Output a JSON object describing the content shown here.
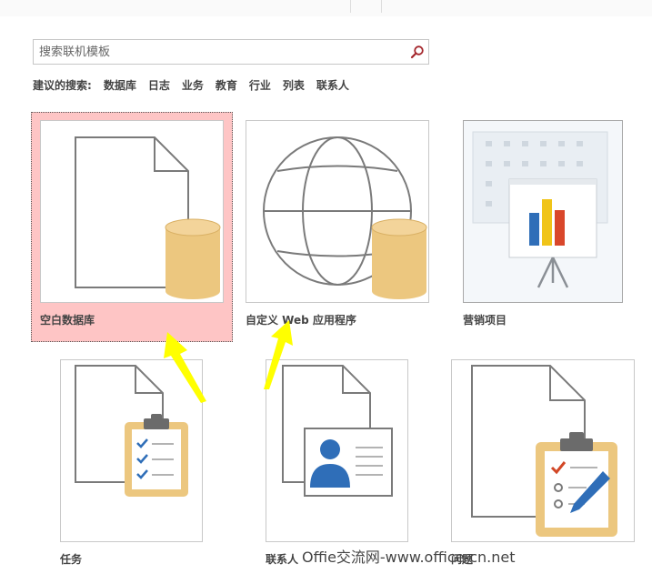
{
  "search": {
    "placeholder": "搜索联机模板"
  },
  "suggestions": {
    "label": "建议的搜索:",
    "items": [
      "数据库",
      "日志",
      "业务",
      "教育",
      "行业",
      "列表",
      "联系人"
    ]
  },
  "templates": [
    {
      "label": "空白数据库",
      "selected": true
    },
    {
      "label": "自定义 Web 应用程序"
    },
    {
      "label": "营销项目"
    },
    {
      "label": "任务"
    },
    {
      "label": "联系人"
    },
    {
      "label": "问题"
    }
  ],
  "watermark": "Offie交流网-www.office-cn.net",
  "colors": {
    "selection": "#fec5c5",
    "db": "#ecc77f",
    "arrow": "#ffff00",
    "accent": "#d24726"
  }
}
